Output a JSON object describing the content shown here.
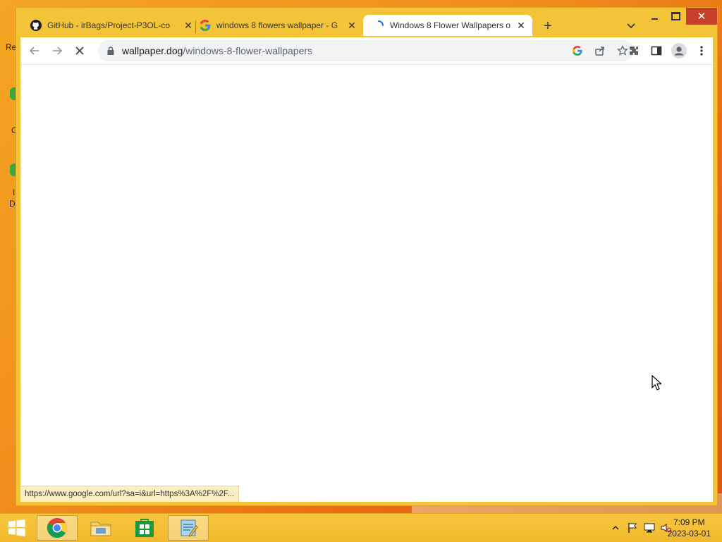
{
  "desktop": {
    "edge_fragments": [
      "Re",
      "C",
      "I",
      "D"
    ]
  },
  "browser": {
    "tabs": [
      {
        "title": "GitHub - irBags/Project-P3OL-co",
        "icon": "github-icon",
        "active": false
      },
      {
        "title": "windows 8 flowers wallpaper - G",
        "icon": "google-icon",
        "active": false
      },
      {
        "title": "Windows 8 Flower Wallpapers o",
        "icon": "loading-spinner-icon",
        "active": true
      }
    ],
    "address": {
      "domain": "wallpaper.dog",
      "path": "/windows-8-flower-wallpapers"
    },
    "status_link": "https://www.google.com/url?sa=i&url=https%3A%2F%2F..."
  },
  "taskbar": {
    "apps": [
      {
        "name": "chrome",
        "icon": "chrome-icon",
        "active": true
      },
      {
        "name": "file-explorer",
        "icon": "folder-icon",
        "active": false
      },
      {
        "name": "store",
        "icon": "store-icon",
        "active": false
      },
      {
        "name": "notepad",
        "icon": "notepad-icon",
        "active": true
      }
    ],
    "clock": {
      "time": "7:09 PM",
      "date": "2023-03-01"
    }
  },
  "colors": {
    "window_frame": "#f3c437",
    "close_button": "#c7402b",
    "taskbar": "#f0b92c"
  }
}
